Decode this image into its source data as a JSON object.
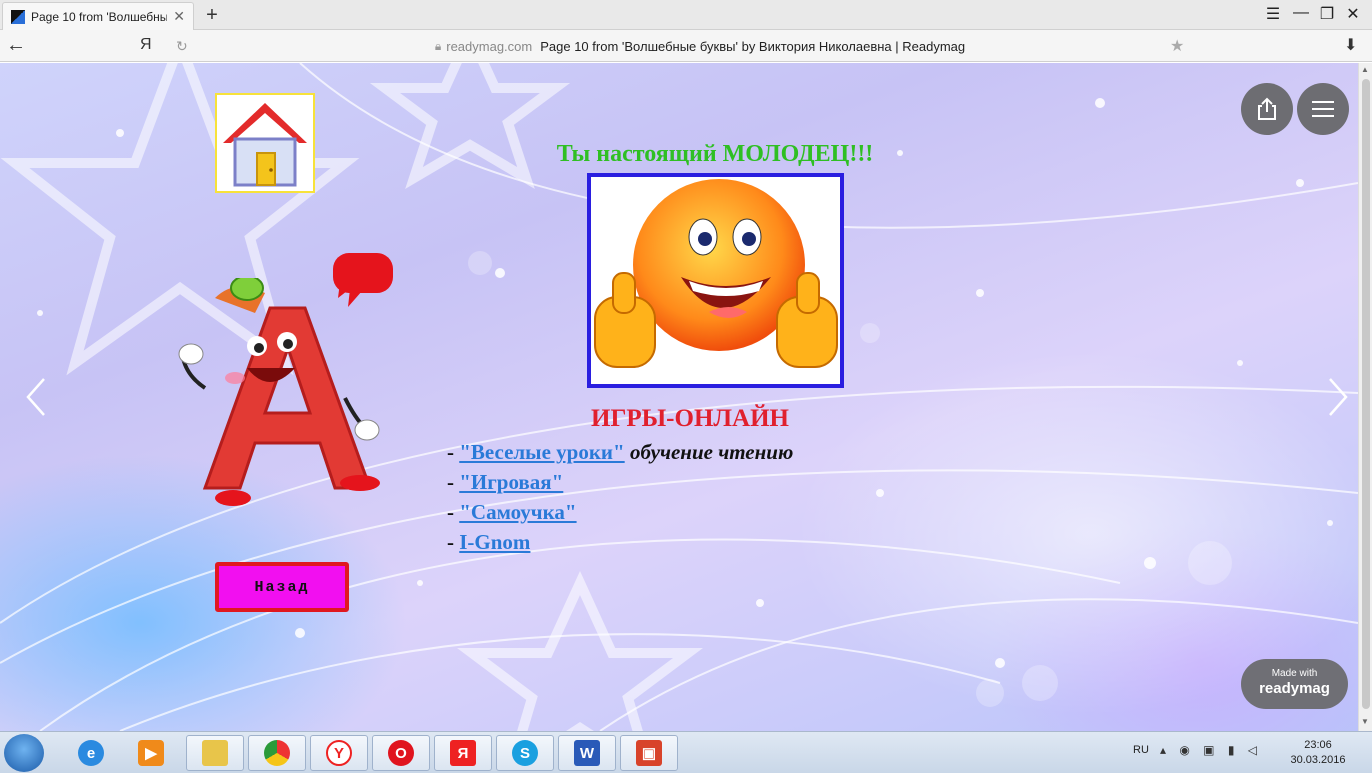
{
  "browser": {
    "tab_title": "Page 10 from 'Волшебны",
    "tab_close": "✕",
    "new_tab": "+",
    "back": "←",
    "ya_button": "Я",
    "reload": "↻",
    "url_domain": "readymag.com",
    "page_title": "Page 10 from 'Волшебные буквы' by Виктория Николаевна | Readymag",
    "star": "★",
    "download": "⬇",
    "window_controls": [
      "☰",
      "—",
      "❐",
      "✕"
    ]
  },
  "page": {
    "title": "Ты настоящий МОЛОДЕЦ!!!",
    "games_heading": "ИГРЫ-ОНЛАЙН",
    "games": [
      {
        "dash": "-",
        "link": "\"Веселые уроки\"",
        "desc": " обучение чтению"
      },
      {
        "dash": "-",
        "link": "\"Игровая\"",
        "desc": ""
      },
      {
        "dash": "-",
        "link": "\"Самоучка\"",
        "desc": ""
      },
      {
        "dash": "-",
        "link": "I-Gnom",
        "desc": ""
      }
    ],
    "back_button": "Назад",
    "made_with_small": "Made with",
    "made_with_brand": "readymag",
    "letter": "А",
    "colors": {
      "title": "#2fbf23",
      "games_heading": "#e0202e",
      "link": "#2a7ad8",
      "back_button_bg": "#f20ff0",
      "back_button_border": "#e01820"
    }
  },
  "taskbar": {
    "items": [
      "internet-explorer-icon",
      "media-player-icon",
      "explorer-icon",
      "chrome-icon",
      "yandex-browser-icon",
      "opera-icon",
      "yandex-icon",
      "skype-icon",
      "word-icon",
      "presentation-icon"
    ],
    "language": "RU",
    "tray": "▴ ◉ ▣ ▮ ◁",
    "time": "23:06",
    "date": "30.03.2016"
  }
}
